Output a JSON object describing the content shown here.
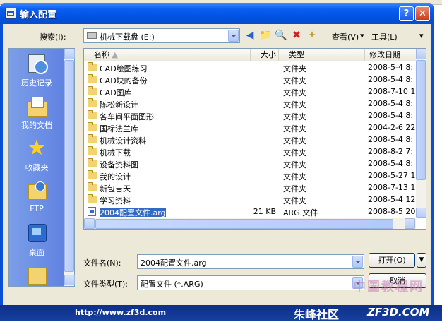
{
  "dialog": {
    "title": "输入配置"
  },
  "lookin": {
    "label": "搜索(I):",
    "value": "机械下载盘 (E:)",
    "view_label": "查看(V)",
    "tools_label": "工具(L)"
  },
  "places": [
    {
      "label": "历史记录",
      "icon": "history-icon"
    },
    {
      "label": "我的文档",
      "icon": "my-documents-icon"
    },
    {
      "label": "收藏夹",
      "icon": "favorites-icon"
    },
    {
      "label": "FTP",
      "icon": "ftp-icon"
    },
    {
      "label": "桌面",
      "icon": "desktop-icon"
    }
  ],
  "columns": {
    "name": "名称",
    "size": "大小",
    "type": "类型",
    "modified": "修改日期"
  },
  "files": [
    {
      "name": "CAD绘图练习",
      "size": "",
      "type": "文件夹",
      "date": "2008-5-4 8:",
      "kind": "folder"
    },
    {
      "name": "CAD块的备份",
      "size": "",
      "type": "文件夹",
      "date": "2008-5-4 8:",
      "kind": "folder"
    },
    {
      "name": "CAD图库",
      "size": "",
      "type": "文件夹",
      "date": "2008-7-10 1",
      "kind": "folder"
    },
    {
      "name": "陈松新设计",
      "size": "",
      "type": "文件夹",
      "date": "2008-5-4 8:",
      "kind": "folder"
    },
    {
      "name": "各车间平面图形",
      "size": "",
      "type": "文件夹",
      "date": "2008-5-4 8:",
      "kind": "folder"
    },
    {
      "name": "国标法兰库",
      "size": "",
      "type": "文件夹",
      "date": "2004-2-6 22",
      "kind": "folder"
    },
    {
      "name": "机械设计资料",
      "size": "",
      "type": "文件夹",
      "date": "2008-5-4 8:",
      "kind": "folder"
    },
    {
      "name": "机械下载",
      "size": "",
      "type": "文件夹",
      "date": "2008-8-2 7:",
      "kind": "folder"
    },
    {
      "name": "设备资料图",
      "size": "",
      "type": "文件夹",
      "date": "2008-5-4 8:",
      "kind": "folder"
    },
    {
      "name": "我的设计",
      "size": "",
      "type": "文件夹",
      "date": "2008-5-27 1",
      "kind": "folder"
    },
    {
      "name": "新包吉天",
      "size": "",
      "type": "文件夹",
      "date": "2008-7-13 1",
      "kind": "folder"
    },
    {
      "name": "学习资料",
      "size": "",
      "type": "文件夹",
      "date": "2008-5-4 12",
      "kind": "folder"
    },
    {
      "name": "2004配置文件.arg",
      "size": "21 KB",
      "type": "ARG 文件",
      "date": "2008-8-5 20",
      "kind": "file"
    }
  ],
  "filename": {
    "label": "文件名(N):",
    "value": "2004配置文件.arg"
  },
  "filetype": {
    "label": "文件类型(T):",
    "value": "配置文件 (*.ARG)"
  },
  "buttons": {
    "open": "打开(O)",
    "cancel": "取消"
  },
  "footer": {
    "url": "http://www.zf3d.com",
    "brand": "朱峰社区",
    "brand2": "ZF3D.COM",
    "watermark": "中国教程网"
  }
}
